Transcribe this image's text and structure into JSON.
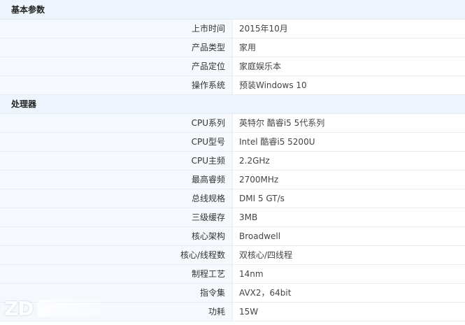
{
  "sections": [
    {
      "title": "基本参数",
      "rows": [
        {
          "label": "上市时间",
          "value": "2015年10月"
        },
        {
          "label": "产品类型",
          "value": "家用"
        },
        {
          "label": "产品定位",
          "value": "家庭娱乐本"
        },
        {
          "label": "操作系统",
          "value": "预装Windows 10"
        }
      ]
    },
    {
      "title": "处理器",
      "rows": [
        {
          "label": "CPU系列",
          "value": "英特尔 酷睿i5 5代系列"
        },
        {
          "label": "CPU型号",
          "value": "Intel 酷睿i5 5200U"
        },
        {
          "label": "CPU主频",
          "value": "2.2GHz"
        },
        {
          "label": "最高睿频",
          "value": "2700MHz"
        },
        {
          "label": "总线规格",
          "value": "DMI 5 GT/s"
        },
        {
          "label": "三级缓存",
          "value": "3MB"
        },
        {
          "label": "核心架构",
          "value": "Broadwell"
        },
        {
          "label": "核心/线程数",
          "value": "双核心/四线程"
        },
        {
          "label": "制程工艺",
          "value": "14nm"
        },
        {
          "label": "指令集",
          "value": "AVX2，64bit"
        },
        {
          "label": "功耗",
          "value": "15W"
        }
      ]
    }
  ],
  "watermark": {
    "logo_text": "ZD"
  },
  "colors": {
    "section_bg": "#edf4fb",
    "label_bg": "#f5f9fd",
    "border": "#e6ecf2"
  }
}
